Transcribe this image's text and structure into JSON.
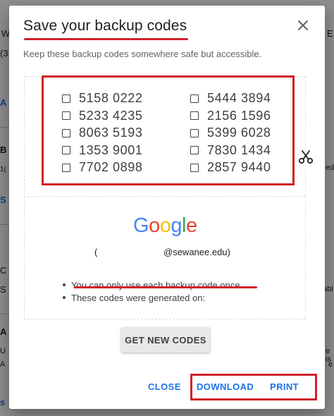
{
  "background": {
    "fragments": [
      "W",
      "(3",
      "A",
      "B",
      "1(",
      "S",
      "C",
      "S",
      "A",
      "U",
      "A",
      "s",
      "E",
      "ed",
      "abl",
      "e is",
      "e"
    ]
  },
  "dialog": {
    "title": "Save your backup codes",
    "subtitle": "Keep these backup codes somewhere safe but accessible.",
    "codes_left": [
      "5158 0222",
      "5233 4235",
      "8063 5193",
      "1353 9001",
      "7702 0898"
    ],
    "codes_right": [
      "5444 3894",
      "2156 1596",
      "5399 6028",
      "7830 1434",
      "2857 9440"
    ],
    "brand": {
      "letters": [
        "G",
        "o",
        "o",
        "g",
        "l",
        "e"
      ],
      "colors": [
        "#4285F4",
        "#EA4335",
        "#FBBC05",
        "#4285F4",
        "#34A853",
        "#EA4335"
      ]
    },
    "account_open_paren": "(",
    "account_email": "@sewanee.edu)",
    "notes": [
      "You can only use each backup code once.",
      "These codes were generated on:"
    ],
    "get_new_codes_label": "GET NEW CODES",
    "actions": {
      "close": "CLOSE",
      "download": "DOWNLOAD",
      "print": "PRINT"
    }
  },
  "colors": {
    "accent": "#1a73e8",
    "annotation_red": "#d0232a"
  }
}
